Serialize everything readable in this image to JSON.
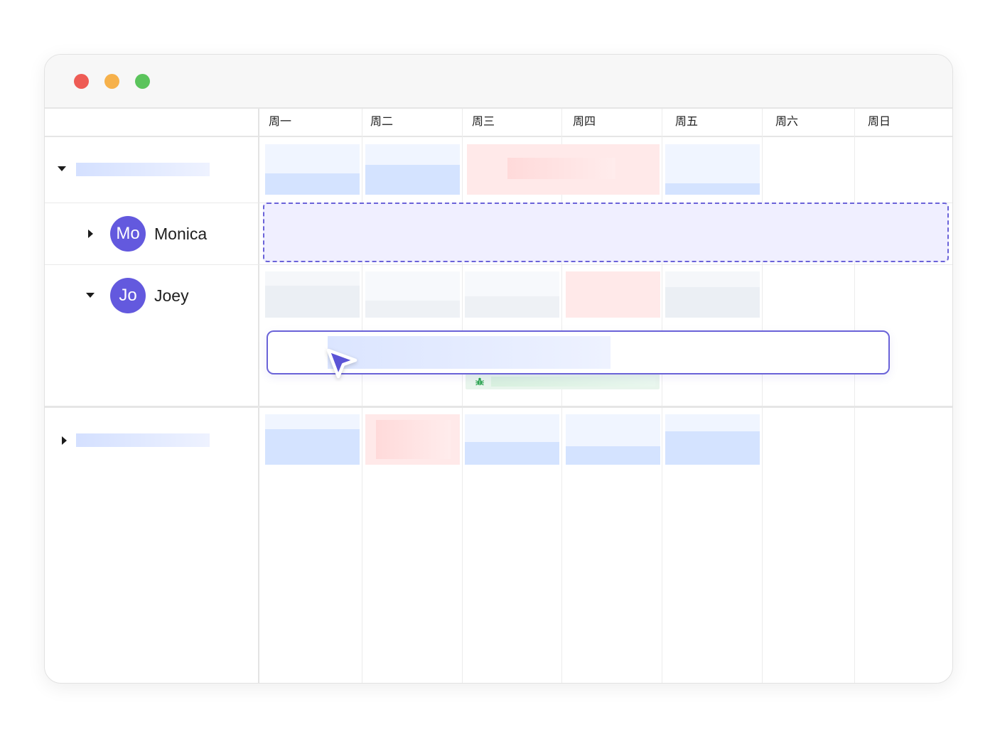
{
  "window": {
    "traffic_lights": [
      {
        "name": "close",
        "color": "#ee5c55"
      },
      {
        "name": "minimize",
        "color": "#f6b14b"
      },
      {
        "name": "zoom",
        "color": "#5bc45c"
      }
    ]
  },
  "calendar": {
    "days": [
      "周一",
      "周二",
      "周三",
      "周四",
      "周五",
      "周六",
      "周日"
    ],
    "rows": [
      {
        "type": "group",
        "expanded": true,
        "label": ""
      },
      {
        "type": "person",
        "expanded": false,
        "initials": "Mo",
        "name": "Monica",
        "avatar_color": "#6359de",
        "selected": true
      },
      {
        "type": "person",
        "expanded": true,
        "initials": "Jo",
        "name": "Joey",
        "avatar_color": "#6359de"
      },
      {
        "type": "group",
        "expanded": false,
        "label": ""
      }
    ]
  },
  "task_colors": {
    "blue_bg": "#f0f5ff",
    "blue_fill": "#d4e3ff",
    "red_bg": "#ffe9e9",
    "red_fill": "#ffdcdc",
    "gray_bg": "#f5f7fa",
    "gray_fill": "#ebeff4",
    "green_bg": "#e8f5ec",
    "accent": "#6a63d8"
  },
  "icons": {
    "bug": "bug-icon",
    "cursor": "cursor-arrow-icon"
  }
}
